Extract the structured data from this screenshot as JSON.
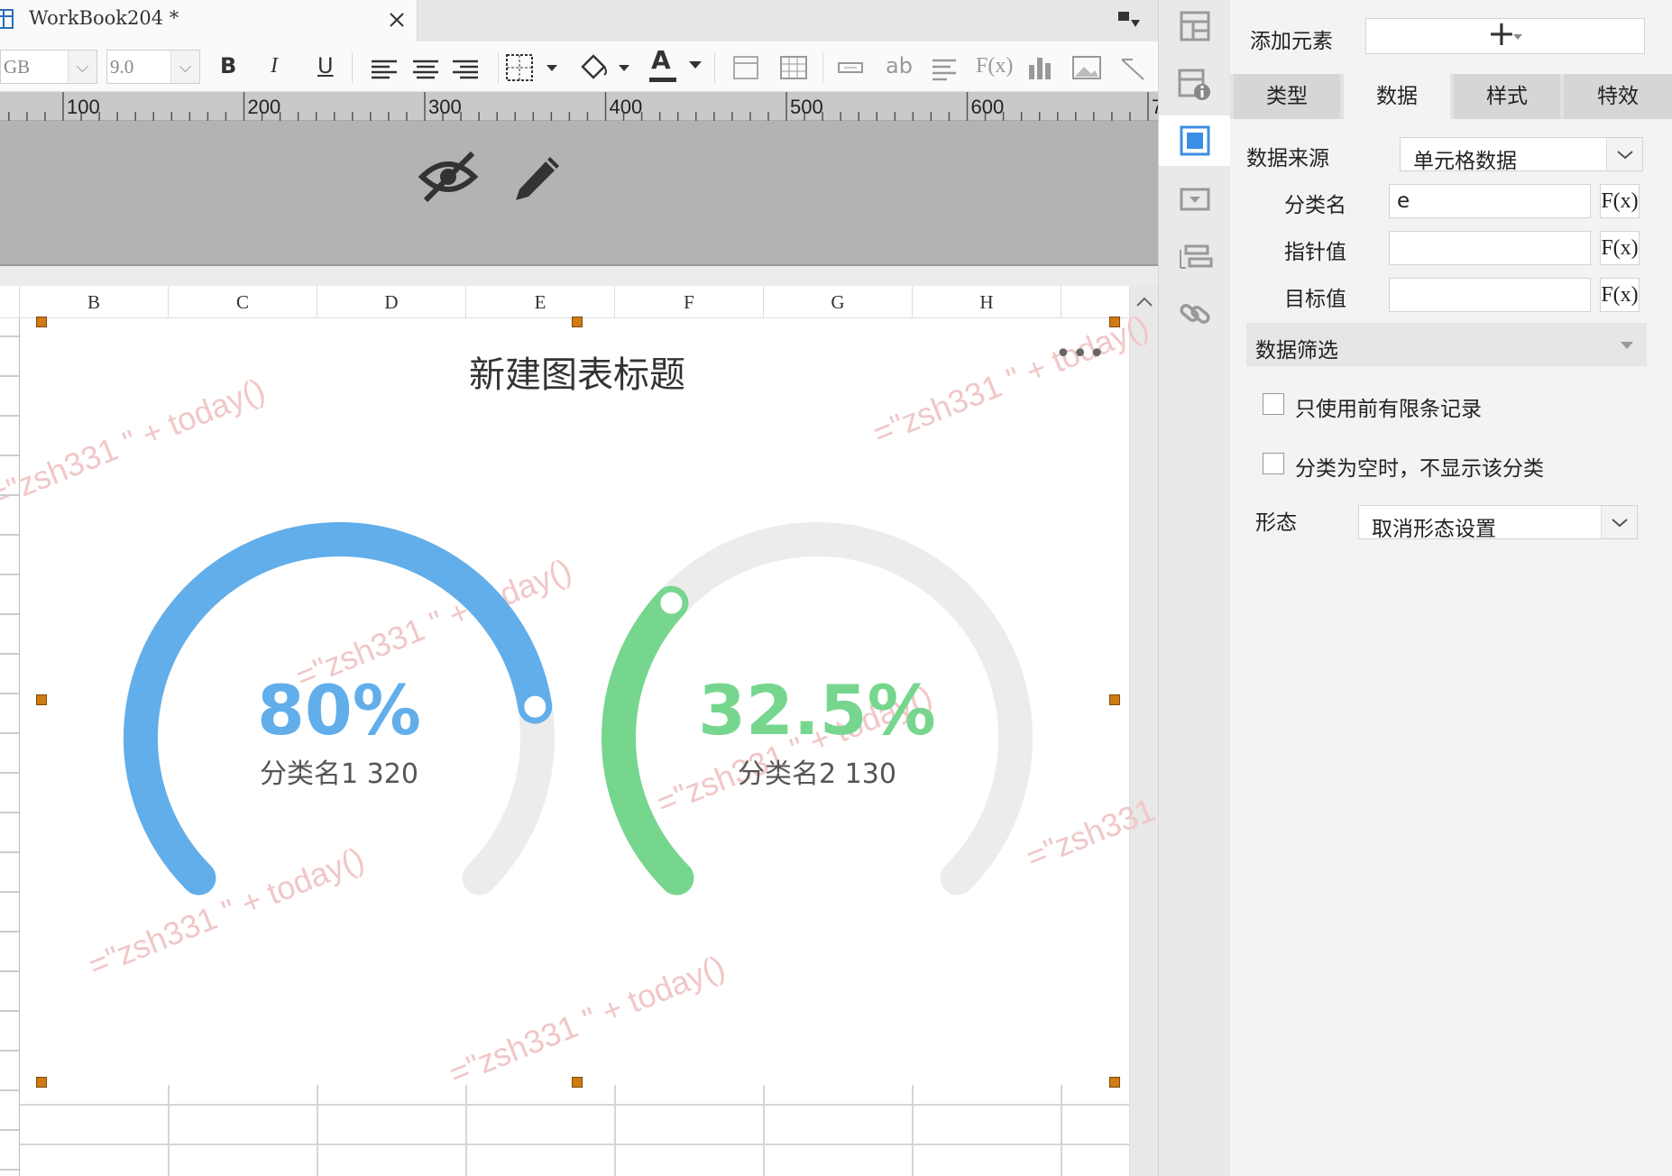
{
  "window": {
    "tab_title": "WorkBook204 *"
  },
  "toolbar": {
    "font_name": "GB",
    "font_size": "9.0",
    "bold": "B",
    "italic": "I",
    "underline": "U",
    "text_color_glyph": "A",
    "ab_label": "ab",
    "fx_label": "F(x)"
  },
  "ruler": {
    "ticks": [
      "100",
      "200",
      "300",
      "400",
      "500",
      "600",
      "7"
    ]
  },
  "columns": [
    "B",
    "C",
    "D",
    "E",
    "F",
    "G",
    "H"
  ],
  "chart": {
    "title": "新建图表标题",
    "menu": "•••",
    "watermark": "=\"zsh331 \" + today()",
    "gauges": [
      {
        "value_text": "80%",
        "label": "分类名1 320",
        "percent": 0.8,
        "color": "#62aeea"
      },
      {
        "value_text": "32.5%",
        "label": "分类名2 130",
        "percent": 0.325,
        "color": "#76d68e"
      }
    ],
    "track_color": "#ececec"
  },
  "panel": {
    "add_element_label": "添加元素",
    "add_button": "+",
    "tabs": [
      "类型",
      "数据",
      "样式",
      "特效"
    ],
    "active_tab": "数据",
    "data_source_label": "数据来源",
    "data_source_value": "单元格数据",
    "category_label": "分类名",
    "category_value": "e",
    "pointer_label": "指针值",
    "pointer_value": "",
    "target_label": "目标值",
    "target_value": "",
    "fx_label": "F(x)",
    "filter_section": "数据筛选",
    "option_limited": "只使用前有限条记录",
    "option_hide_empty": "分类为空时，不显示该分类",
    "form_label": "形态",
    "form_value": "取消形态设置"
  },
  "icons": [
    "grid-icon",
    "info-icon",
    "select-frame-icon",
    "dropdown-widget-icon",
    "layer-icon",
    "link-icon",
    "eye-off-icon",
    "pencil-icon",
    "close-icon",
    "collapse-icon"
  ]
}
